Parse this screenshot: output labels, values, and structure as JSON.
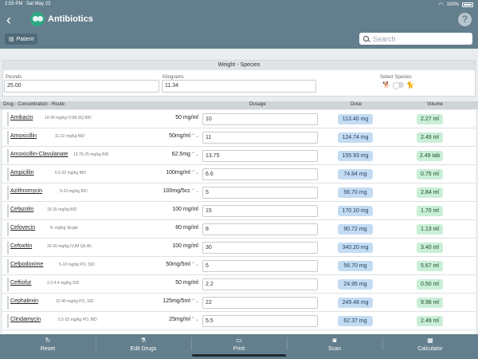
{
  "status": {
    "time": "2:55 PM",
    "date": "Sat May 23",
    "battery": "100%"
  },
  "header": {
    "title": "Antibiotics",
    "back_icon": "chevron-left-icon",
    "help_label": "?"
  },
  "patient": {
    "label": "Patient"
  },
  "search": {
    "placeholder": "Search"
  },
  "weight": {
    "title": "Weight - Species",
    "pounds_label": "Pounds",
    "pounds_value": "25.00",
    "kilograms_label": "Kilograms",
    "kilograms_value": "11.34",
    "species_label": "Select Species"
  },
  "table": {
    "col_drug": "Drug - Concentration - Route",
    "col_dosage": "Dosage",
    "col_dose": "Dose",
    "col_volume": "Volume",
    "rows": [
      {
        "name": "Amikacin",
        "range": "10-30 mg/kg IV,IM,SQ BID",
        "conc": "50 mg/ml",
        "chev": "",
        "dosage": "10",
        "dose": "113.40 mg",
        "volume": "2.27 ml"
      },
      {
        "name": "Amoxicillin",
        "range": "11-22 mg/kg BID",
        "conc": "50mg/ml",
        "chev": "⌃⌄",
        "dosage": "11",
        "dose": "124.74 mg",
        "volume": "2.49 ml"
      },
      {
        "name": "Amoxicillin-Clavulanate",
        "range": "13.75-25 mg/kg BID",
        "conc": "62.5mg",
        "chev": "⌃⌄",
        "dosage": "13.75",
        "dose": "155.93 mg",
        "volume": "2.49 tab"
      },
      {
        "name": "Ampicillin",
        "range": "6.6-22 mg/kg BID",
        "conc": "100mg/ml",
        "chev": "⌃⌄",
        "dosage": "6.6",
        "dose": "74.84 mg",
        "volume": "0.75 ml"
      },
      {
        "name": "Azithromycin",
        "range": "5-10 mg/kg BID",
        "conc": "100mg/5cc",
        "chev": "⌃⌄",
        "dosage": "5",
        "dose": "56.70 mg",
        "volume": "2.84 ml"
      },
      {
        "name": "Cefazolin",
        "range": "15-35 mg/kg BID",
        "conc": "100 mg/ml",
        "chev": "",
        "dosage": "15",
        "dose": "170.10 mg",
        "volume": "1.70 ml"
      },
      {
        "name": "Cefovecin",
        "range": "8- mg/kg Single",
        "conc": "80 mg/ml",
        "chev": "",
        "dosage": "8",
        "dose": "90.72 mg",
        "volume": "1.13 ml"
      },
      {
        "name": "Cefoxitin",
        "range": "15-30 mg/kg IV,IM Q6-8h",
        "conc": "100 mg/ml",
        "chev": "",
        "dosage": "30",
        "dose": "340.20 mg",
        "volume": "3.40 ml"
      },
      {
        "name": "Cefpodoxime",
        "range": "5-10 mg/kg PO, SID",
        "conc": "50mg/5ml",
        "chev": "⌃⌄",
        "dosage": "5",
        "dose": "56.70 mg",
        "volume": "5.67 ml"
      },
      {
        "name": "Ceftiofur",
        "range": "2.2-4.4 mg/kg SID",
        "conc": "50 mg/ml",
        "chev": "",
        "dosage": "2.2",
        "dose": "24.95 mg",
        "volume": "0.50 ml"
      },
      {
        "name": "Cephalexin",
        "range": "22-40 mg/kg PO, SID",
        "conc": "125mg/5ml",
        "chev": "⌃⌄",
        "dosage": "22",
        "dose": "249.48 mg",
        "volume": "9.98 ml"
      },
      {
        "name": "Clindamycin",
        "range": "5.5-33 mg/kg PO, BID",
        "conc": "25mg/ml",
        "chev": "⌃⌄",
        "dosage": "5.5",
        "dose": "62.37 mg",
        "volume": "2.49 ml"
      }
    ]
  },
  "toolbar": {
    "reset": "Reset",
    "edit_drugs": "Edit Drugs",
    "print": "Print",
    "scan": "Scan",
    "calculator": "Calculator"
  },
  "colors": {
    "header_bg": "#637f8d",
    "dose_pill": "#c3dcf3",
    "volume_pill": "#c9efd6",
    "logo": "#2fa884"
  }
}
